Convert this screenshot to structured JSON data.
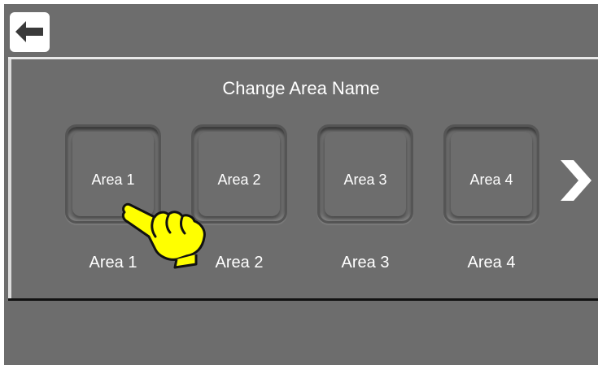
{
  "header": {
    "back_icon": "arrow-left-icon"
  },
  "page": {
    "title": "Change Area Name"
  },
  "areas": [
    {
      "button_label": "Area 1",
      "caption": "Area 1"
    },
    {
      "button_label": "Area 2",
      "caption": "Area 2"
    },
    {
      "button_label": "Area 3",
      "caption": "Area 3"
    },
    {
      "button_label": "Area 4",
      "caption": "Area 4"
    }
  ],
  "navigation": {
    "next_icon": "chevron-right-icon"
  },
  "overlay": {
    "pointer_icon": "pointing-hand-icon",
    "pointer_color": "#ffff00"
  },
  "colors": {
    "background": "#6d6d6d",
    "text": "#ffffff"
  }
}
